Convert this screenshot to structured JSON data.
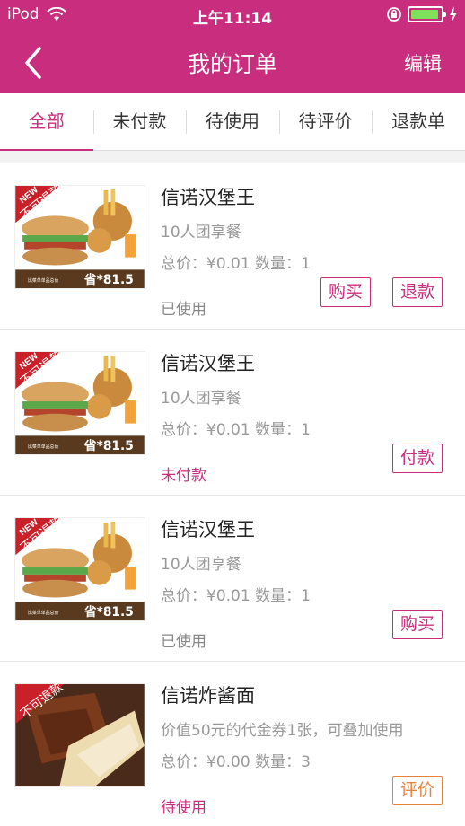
{
  "status_bar": {
    "carrier": "iPod",
    "time": "上午11:14"
  },
  "header": {
    "title": "我的订单",
    "edit_label": "编辑"
  },
  "tabs": [
    {
      "label": "全部",
      "active": true
    },
    {
      "label": "未付款"
    },
    {
      "label": "待使用"
    },
    {
      "label": "待评价"
    },
    {
      "label": "退款单"
    }
  ],
  "orders": [
    {
      "name": "信诺汉堡王",
      "desc": "10人团享餐",
      "price": "总价：¥0.01 数量：1",
      "status": "已使用",
      "badge": "不可退款",
      "new_tag": "NEW",
      "save_price": "省*81.5",
      "caption": "比菜单单品总价",
      "actions": [
        "购买",
        "退款"
      ]
    },
    {
      "name": "信诺汉堡王",
      "desc": "10人团享餐",
      "price": "总价：¥0.01 数量：1",
      "status": "未付款",
      "badge": "不可退款",
      "new_tag": "NEW",
      "save_price": "省*81.5",
      "caption": "比菜单单品总价",
      "actions": [
        "付款"
      ]
    },
    {
      "name": "信诺汉堡王",
      "desc": "10人团享餐",
      "price": "总价：¥0.01 数量：1",
      "status": "已使用",
      "badge": "不可退款",
      "new_tag": "NEW",
      "save_price": "省*81.5",
      "caption": "比菜单单品总价",
      "actions": [
        "购买"
      ]
    },
    {
      "name": "信诺炸酱面",
      "desc": "价值50元的代金券1张，可叠加使用",
      "price": "总价：¥0.00 数量：3",
      "status": "待使用",
      "badge": "不可退款",
      "actions": [
        "评价"
      ]
    }
  ],
  "colors": {
    "brand": "#c92e7e",
    "orange": "#e8823a"
  }
}
